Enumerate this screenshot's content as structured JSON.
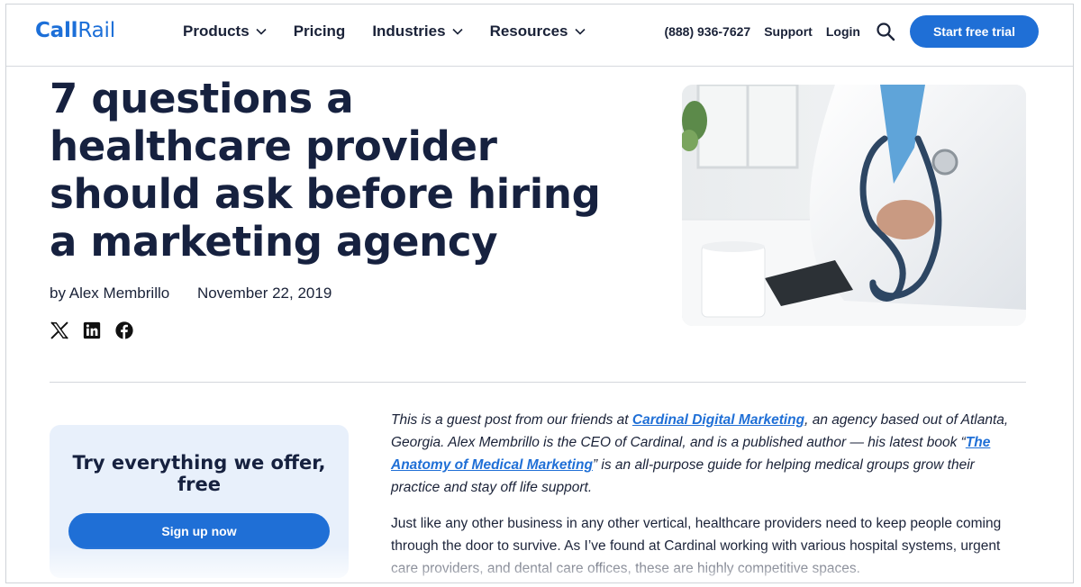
{
  "nav": {
    "logo_bold": "Call",
    "logo_light": "Rail",
    "menu": [
      {
        "label": "Products",
        "dropdown": true
      },
      {
        "label": "Pricing",
        "dropdown": false
      },
      {
        "label": "Industries",
        "dropdown": true
      },
      {
        "label": "Resources",
        "dropdown": true
      }
    ],
    "phone": "(888) 936-7627",
    "support": "Support",
    "login": "Login",
    "search_icon": "search-icon",
    "cta": "Start free trial"
  },
  "article": {
    "title": "7 questions a healthcare provider should ask before hiring a marketing agency",
    "author": "by Alex Membrillo",
    "date": "November 22, 2019",
    "share_icons": [
      "x-icon",
      "linkedin-icon",
      "facebook-icon"
    ],
    "intro": {
      "p1": "This is a guest post from our friends at ",
      "link1": "Cardinal Digital Marketing",
      "p2": ", an agency based out of Atlanta, Georgia. Alex Membrillo is the CEO of Cardinal, and is a published author — his latest book “",
      "link2": "The Anatomy of Medical Marketing",
      "p3": "” is an all-purpose guide for helping medical groups grow their practice and stay off life support."
    },
    "paragraph": "Just like any other business in any other vertical, healthcare providers need to keep people coming through the door to survive. As I’ve found at Cardinal working with various hospital systems, urgent care providers, and dental care offices, these are highly competitive spaces."
  },
  "cta_box": {
    "title_line1": "Try everything we offer,",
    "title_line2": "free",
    "button": "Sign up now"
  },
  "colors": {
    "brand_blue": "#1f6fd6",
    "heading": "#16213f",
    "cta_bg": "#e8f0fb"
  }
}
